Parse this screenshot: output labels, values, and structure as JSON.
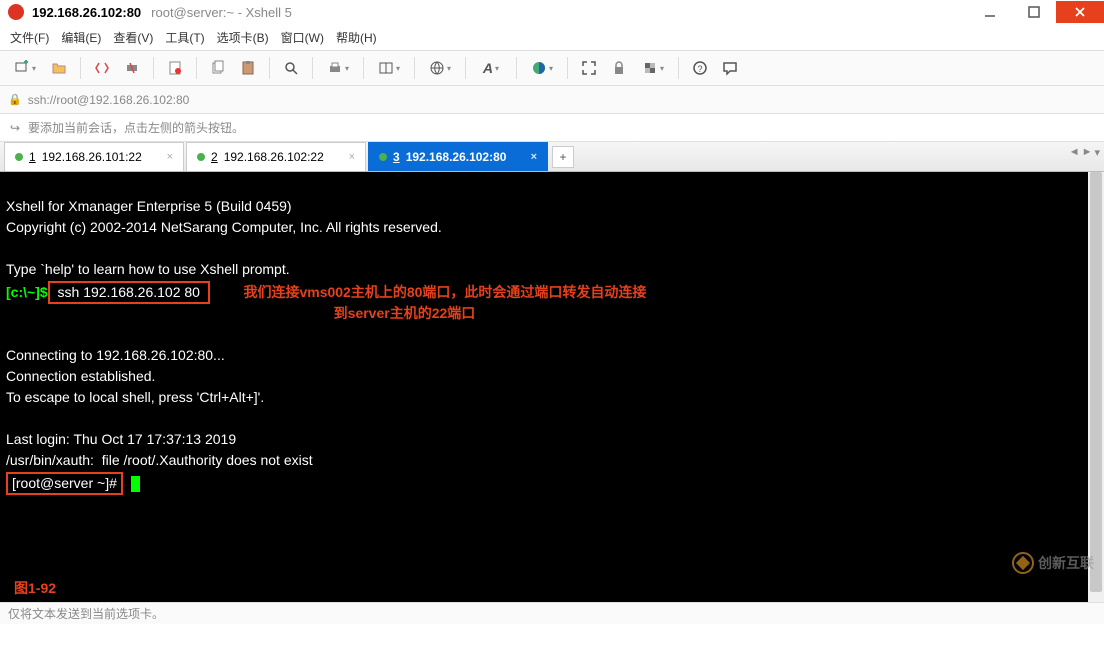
{
  "window": {
    "title_main": "192.168.26.102:80",
    "title_sub": "root@server:~ - Xshell 5"
  },
  "menu": {
    "file": "文件(F)",
    "edit": "编辑(E)",
    "view": "查看(V)",
    "tools": "工具(T)",
    "tabs": "选项卡(B)",
    "window": "窗口(W)",
    "help": "帮助(H)"
  },
  "address": {
    "url": "ssh://root@192.168.26.102:80"
  },
  "info_bar": {
    "text": "要添加当前会话，点击左侧的箭头按钮。"
  },
  "tabs": [
    {
      "num": "1",
      "label": "192.168.26.101:22",
      "active": false
    },
    {
      "num": "2",
      "label": "192.168.26.102:22",
      "active": false
    },
    {
      "num": "3",
      "label": "192.168.26.102:80",
      "active": true
    }
  ],
  "tab_add": "+",
  "terminal": {
    "line1": "Xshell for Xmanager Enterprise 5 (Build 0459)",
    "line2": "Copyright (c) 2002-2014 NetSarang Computer, Inc. All rights reserved.",
    "line3": "",
    "line4": "Type `help' to learn how to use Xshell prompt.",
    "prompt1_pre": "[c:\\~]$",
    "cmd1": " ssh 192.168.26.102 80 ",
    "annot1": "我们连接vms002主机上的80端口，此时会通过端口转发自动连接",
    "annot2": "到server主机的22端口",
    "line5": "",
    "line6": "Connecting to 192.168.26.102:80...",
    "line7": "Connection established.",
    "line8": "To escape to local shell, press 'Ctrl+Alt+]'.",
    "line9": "",
    "line10": "Last login: Thu Oct 17 17:37:13 2019",
    "line11": "/usr/bin/xauth:  file /root/.Xauthority does not exist",
    "prompt2": "[root@server ~]#",
    "figure": "图1-92"
  },
  "status": {
    "text": "仅将文本发送到当前选项卡。"
  },
  "watermark": {
    "text": "创新互联"
  }
}
